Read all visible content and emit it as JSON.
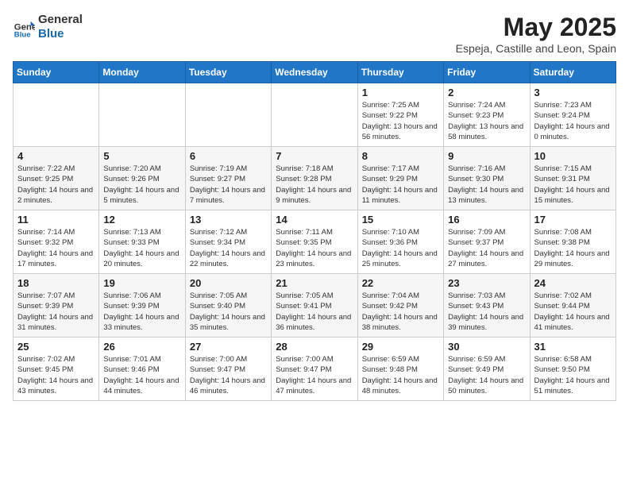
{
  "header": {
    "logo_line1": "General",
    "logo_line2": "Blue",
    "title": "May 2025",
    "subtitle": "Espeja, Castille and Leon, Spain"
  },
  "weekdays": [
    "Sunday",
    "Monday",
    "Tuesday",
    "Wednesday",
    "Thursday",
    "Friday",
    "Saturday"
  ],
  "weeks": [
    [
      {
        "day": "",
        "info": ""
      },
      {
        "day": "",
        "info": ""
      },
      {
        "day": "",
        "info": ""
      },
      {
        "day": "",
        "info": ""
      },
      {
        "day": "1",
        "info": "Sunrise: 7:25 AM\nSunset: 9:22 PM\nDaylight: 13 hours\nand 56 minutes."
      },
      {
        "day": "2",
        "info": "Sunrise: 7:24 AM\nSunset: 9:23 PM\nDaylight: 13 hours\nand 58 minutes."
      },
      {
        "day": "3",
        "info": "Sunrise: 7:23 AM\nSunset: 9:24 PM\nDaylight: 14 hours\nand 0 minutes."
      }
    ],
    [
      {
        "day": "4",
        "info": "Sunrise: 7:22 AM\nSunset: 9:25 PM\nDaylight: 14 hours\nand 2 minutes."
      },
      {
        "day": "5",
        "info": "Sunrise: 7:20 AM\nSunset: 9:26 PM\nDaylight: 14 hours\nand 5 minutes."
      },
      {
        "day": "6",
        "info": "Sunrise: 7:19 AM\nSunset: 9:27 PM\nDaylight: 14 hours\nand 7 minutes."
      },
      {
        "day": "7",
        "info": "Sunrise: 7:18 AM\nSunset: 9:28 PM\nDaylight: 14 hours\nand 9 minutes."
      },
      {
        "day": "8",
        "info": "Sunrise: 7:17 AM\nSunset: 9:29 PM\nDaylight: 14 hours\nand 11 minutes."
      },
      {
        "day": "9",
        "info": "Sunrise: 7:16 AM\nSunset: 9:30 PM\nDaylight: 14 hours\nand 13 minutes."
      },
      {
        "day": "10",
        "info": "Sunrise: 7:15 AM\nSunset: 9:31 PM\nDaylight: 14 hours\nand 15 minutes."
      }
    ],
    [
      {
        "day": "11",
        "info": "Sunrise: 7:14 AM\nSunset: 9:32 PM\nDaylight: 14 hours\nand 17 minutes."
      },
      {
        "day": "12",
        "info": "Sunrise: 7:13 AM\nSunset: 9:33 PM\nDaylight: 14 hours\nand 20 minutes."
      },
      {
        "day": "13",
        "info": "Sunrise: 7:12 AM\nSunset: 9:34 PM\nDaylight: 14 hours\nand 22 minutes."
      },
      {
        "day": "14",
        "info": "Sunrise: 7:11 AM\nSunset: 9:35 PM\nDaylight: 14 hours\nand 23 minutes."
      },
      {
        "day": "15",
        "info": "Sunrise: 7:10 AM\nSunset: 9:36 PM\nDaylight: 14 hours\nand 25 minutes."
      },
      {
        "day": "16",
        "info": "Sunrise: 7:09 AM\nSunset: 9:37 PM\nDaylight: 14 hours\nand 27 minutes."
      },
      {
        "day": "17",
        "info": "Sunrise: 7:08 AM\nSunset: 9:38 PM\nDaylight: 14 hours\nand 29 minutes."
      }
    ],
    [
      {
        "day": "18",
        "info": "Sunrise: 7:07 AM\nSunset: 9:39 PM\nDaylight: 14 hours\nand 31 minutes."
      },
      {
        "day": "19",
        "info": "Sunrise: 7:06 AM\nSunset: 9:39 PM\nDaylight: 14 hours\nand 33 minutes."
      },
      {
        "day": "20",
        "info": "Sunrise: 7:05 AM\nSunset: 9:40 PM\nDaylight: 14 hours\nand 35 minutes."
      },
      {
        "day": "21",
        "info": "Sunrise: 7:05 AM\nSunset: 9:41 PM\nDaylight: 14 hours\nand 36 minutes."
      },
      {
        "day": "22",
        "info": "Sunrise: 7:04 AM\nSunset: 9:42 PM\nDaylight: 14 hours\nand 38 minutes."
      },
      {
        "day": "23",
        "info": "Sunrise: 7:03 AM\nSunset: 9:43 PM\nDaylight: 14 hours\nand 39 minutes."
      },
      {
        "day": "24",
        "info": "Sunrise: 7:02 AM\nSunset: 9:44 PM\nDaylight: 14 hours\nand 41 minutes."
      }
    ],
    [
      {
        "day": "25",
        "info": "Sunrise: 7:02 AM\nSunset: 9:45 PM\nDaylight: 14 hours\nand 43 minutes."
      },
      {
        "day": "26",
        "info": "Sunrise: 7:01 AM\nSunset: 9:46 PM\nDaylight: 14 hours\nand 44 minutes."
      },
      {
        "day": "27",
        "info": "Sunrise: 7:00 AM\nSunset: 9:47 PM\nDaylight: 14 hours\nand 46 minutes."
      },
      {
        "day": "28",
        "info": "Sunrise: 7:00 AM\nSunset: 9:47 PM\nDaylight: 14 hours\nand 47 minutes."
      },
      {
        "day": "29",
        "info": "Sunrise: 6:59 AM\nSunset: 9:48 PM\nDaylight: 14 hours\nand 48 minutes."
      },
      {
        "day": "30",
        "info": "Sunrise: 6:59 AM\nSunset: 9:49 PM\nDaylight: 14 hours\nand 50 minutes."
      },
      {
        "day": "31",
        "info": "Sunrise: 6:58 AM\nSunset: 9:50 PM\nDaylight: 14 hours\nand 51 minutes."
      }
    ]
  ]
}
